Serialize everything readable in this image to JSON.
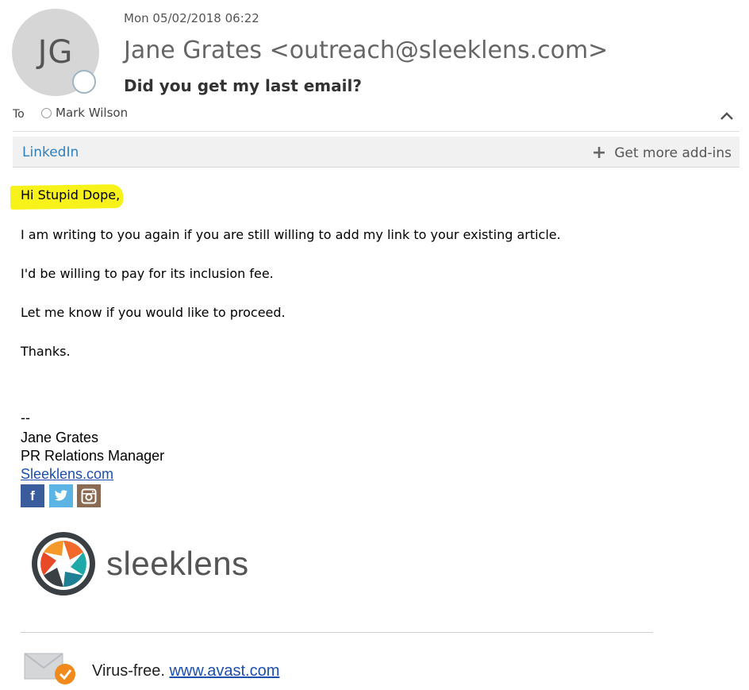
{
  "header": {
    "avatar_initials": "JG",
    "date": "Mon 05/02/2018 06:22",
    "sender": "Jane Grates <outreach@sleeklens.com>",
    "subject": "Did you get my last email?",
    "to_label": "To",
    "recipient": "Mark Wilson"
  },
  "addin_bar": {
    "linkedin_label": "LinkedIn",
    "get_addins_label": "Get more add-ins"
  },
  "body": {
    "greeting": "Hi Stupid Dope,",
    "lines": [
      "I am writing to you again if you are still willing to add my link to your existing article.",
      "I'd be willing to pay for its inclusion fee.",
      "Let me know if you would like to proceed.",
      "Thanks."
    ]
  },
  "signature": {
    "dash": "--",
    "name": "Jane Grates",
    "title": "PR Relations Manager",
    "website": "Sleeklens.com",
    "logo_text": "sleeklens"
  },
  "footer": {
    "virus_free": "Virus-free.",
    "avast_link": "www.avast.com"
  },
  "colors": {
    "highlight": "#f7f31a",
    "link": "#1c4fb0",
    "linkedin": "#2f7fbe",
    "facebook": "#3b5c9c",
    "twitter": "#5bb4e3",
    "instagram": "#8a6a52"
  }
}
